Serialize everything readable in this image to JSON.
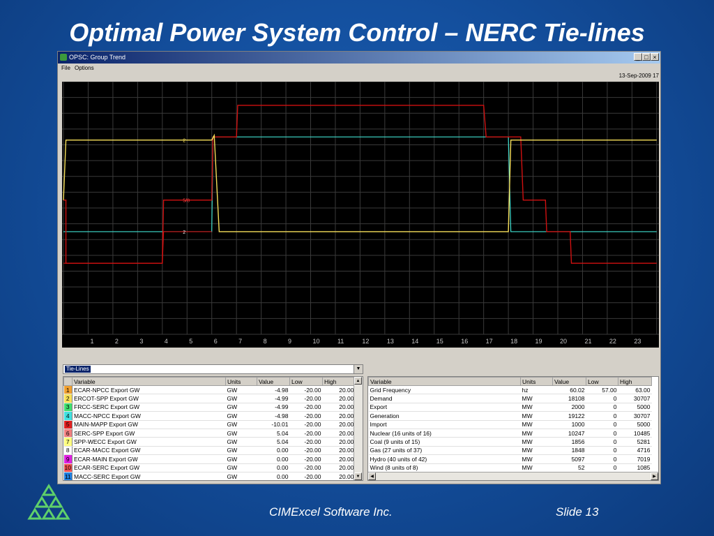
{
  "slide": {
    "title": "Optimal Power System Control – NERC Tie-lines",
    "footer_company": "CIMExcel Software Inc.",
    "footer_slide": "Slide 13"
  },
  "window": {
    "title": "OPSC: Group Trend",
    "controls": {
      "minimize": "_",
      "maximize": "□",
      "close": "×"
    },
    "menu": [
      "File",
      "Options"
    ],
    "timestamp": "13-Sep-2009 17"
  },
  "chart": {
    "x_ticks": [
      "1",
      "2",
      "3",
      "4",
      "5",
      "6",
      "7",
      "8",
      "9",
      "10",
      "11",
      "12",
      "13",
      "14",
      "15",
      "16",
      "17",
      "18",
      "19",
      "20",
      "21",
      "22",
      "23"
    ],
    "background": "#000000",
    "grid_color": "#3a3a3a",
    "markers": [
      "2",
      "5/8",
      "2"
    ]
  },
  "chart_data": {
    "type": "line",
    "x": [
      0,
      1,
      2,
      3,
      4,
      4.5,
      5,
      6,
      7,
      8,
      9,
      10,
      11,
      12,
      13,
      14,
      15,
      16,
      17,
      17.2,
      17.8,
      18,
      19,
      20,
      21,
      22,
      23,
      24
    ],
    "series": [
      {
        "name": "ECAR-NPCC Export GW",
        "color": "#f7e05a",
        "shape": "high-low-high pulse at x≈6 and x≈18"
      },
      {
        "name": "MAIN-MAPP Export GW",
        "color": "#d01010",
        "shape": "steps low→mid→high→mid→low"
      },
      {
        "name": "MACC-NPCC Export GW",
        "color": "#40e0d0"
      }
    ]
  },
  "group_select": {
    "value": "Tie-Lines"
  },
  "left_table": {
    "headers": [
      "Variable",
      "Units",
      "Value",
      "Low",
      "High"
    ],
    "rows": [
      {
        "idx": "1",
        "color": "#f0a030",
        "variable": "ECAR-NPCC Export GW",
        "units": "GW",
        "value": "-4.98",
        "low": "-20.00",
        "high": "20.00"
      },
      {
        "idx": "2",
        "color": "#f7e05a",
        "variable": "ERCOT-SPP Export GW",
        "units": "GW",
        "value": "-4.99",
        "low": "-20.00",
        "high": "20.00"
      },
      {
        "idx": "3",
        "color": "#40e070",
        "variable": "FRCC-SERC Export GW",
        "units": "GW",
        "value": "-4.99",
        "low": "-20.00",
        "high": "20.00"
      },
      {
        "idx": "4",
        "color": "#40e0e0",
        "variable": "MACC-NPCC Export GW",
        "units": "GW",
        "value": "-4.98",
        "low": "-20.00",
        "high": "20.00"
      },
      {
        "idx": "5",
        "color": "#e02020",
        "variable": "MAIN-MAPP Export GW",
        "units": "GW",
        "value": "-10.01",
        "low": "-20.00",
        "high": "20.00"
      },
      {
        "idx": "6",
        "color": "#f08080",
        "variable": "SERC-SPP Export GW",
        "units": "GW",
        "value": "5.04",
        "low": "-20.00",
        "high": "20.00"
      },
      {
        "idx": "7",
        "color": "#ffff80",
        "variable": "SPP-WECC Export GW",
        "units": "GW",
        "value": "5.04",
        "low": "-20.00",
        "high": "20.00"
      },
      {
        "idx": "8",
        "color": "#ffffff",
        "variable": "ECAR-MACC Export GW",
        "units": "GW",
        "value": "0.00",
        "low": "-20.00",
        "high": "20.00"
      },
      {
        "idx": "9",
        "color": "#e020e0",
        "variable": "ECAR-MAIN Export GW",
        "units": "GW",
        "value": "0.00",
        "low": "-20.00",
        "high": "20.00"
      },
      {
        "idx": "10",
        "color": "#f05050",
        "variable": "ECAR-SERC Export GW",
        "units": "GW",
        "value": "0.00",
        "low": "-20.00",
        "high": "20.00"
      },
      {
        "idx": "11",
        "color": "#2080e0",
        "variable": "MACC-SERC Export GW",
        "units": "GW",
        "value": "0.00",
        "low": "-20.00",
        "high": "20.00"
      }
    ]
  },
  "right_table": {
    "headers": [
      "Variable",
      "Units",
      "Value",
      "Low",
      "High"
    ],
    "rows": [
      {
        "variable": "Grid Frequency",
        "units": "hz",
        "value": "60.02",
        "low": "57.00",
        "high": "63.00"
      },
      {
        "variable": "Demand",
        "units": "MW",
        "value": "18108",
        "low": "0",
        "high": "30707"
      },
      {
        "variable": "Export",
        "units": "MW",
        "value": "2000",
        "low": "0",
        "high": "5000"
      },
      {
        "variable": "Generation",
        "units": "MW",
        "value": "19122",
        "low": "0",
        "high": "30707"
      },
      {
        "variable": "Import",
        "units": "MW",
        "value": "1000",
        "low": "0",
        "high": "5000"
      },
      {
        "variable": "Nuclear  (16 units of 16)",
        "units": "MW",
        "value": "10247",
        "low": "0",
        "high": "10485"
      },
      {
        "variable": "Coal  (9 units of 15)",
        "units": "MW",
        "value": "1856",
        "low": "0",
        "high": "5281"
      },
      {
        "variable": "Gas  (27 units of 37)",
        "units": "MW",
        "value": "1848",
        "low": "0",
        "high": "4716"
      },
      {
        "variable": "Hydro  (40 units of 42)",
        "units": "MW",
        "value": "5097",
        "low": "0",
        "high": "7019"
      },
      {
        "variable": "Wind  (8 units of 8)",
        "units": "MW",
        "value": "52",
        "low": "0",
        "high": "1085"
      }
    ]
  }
}
